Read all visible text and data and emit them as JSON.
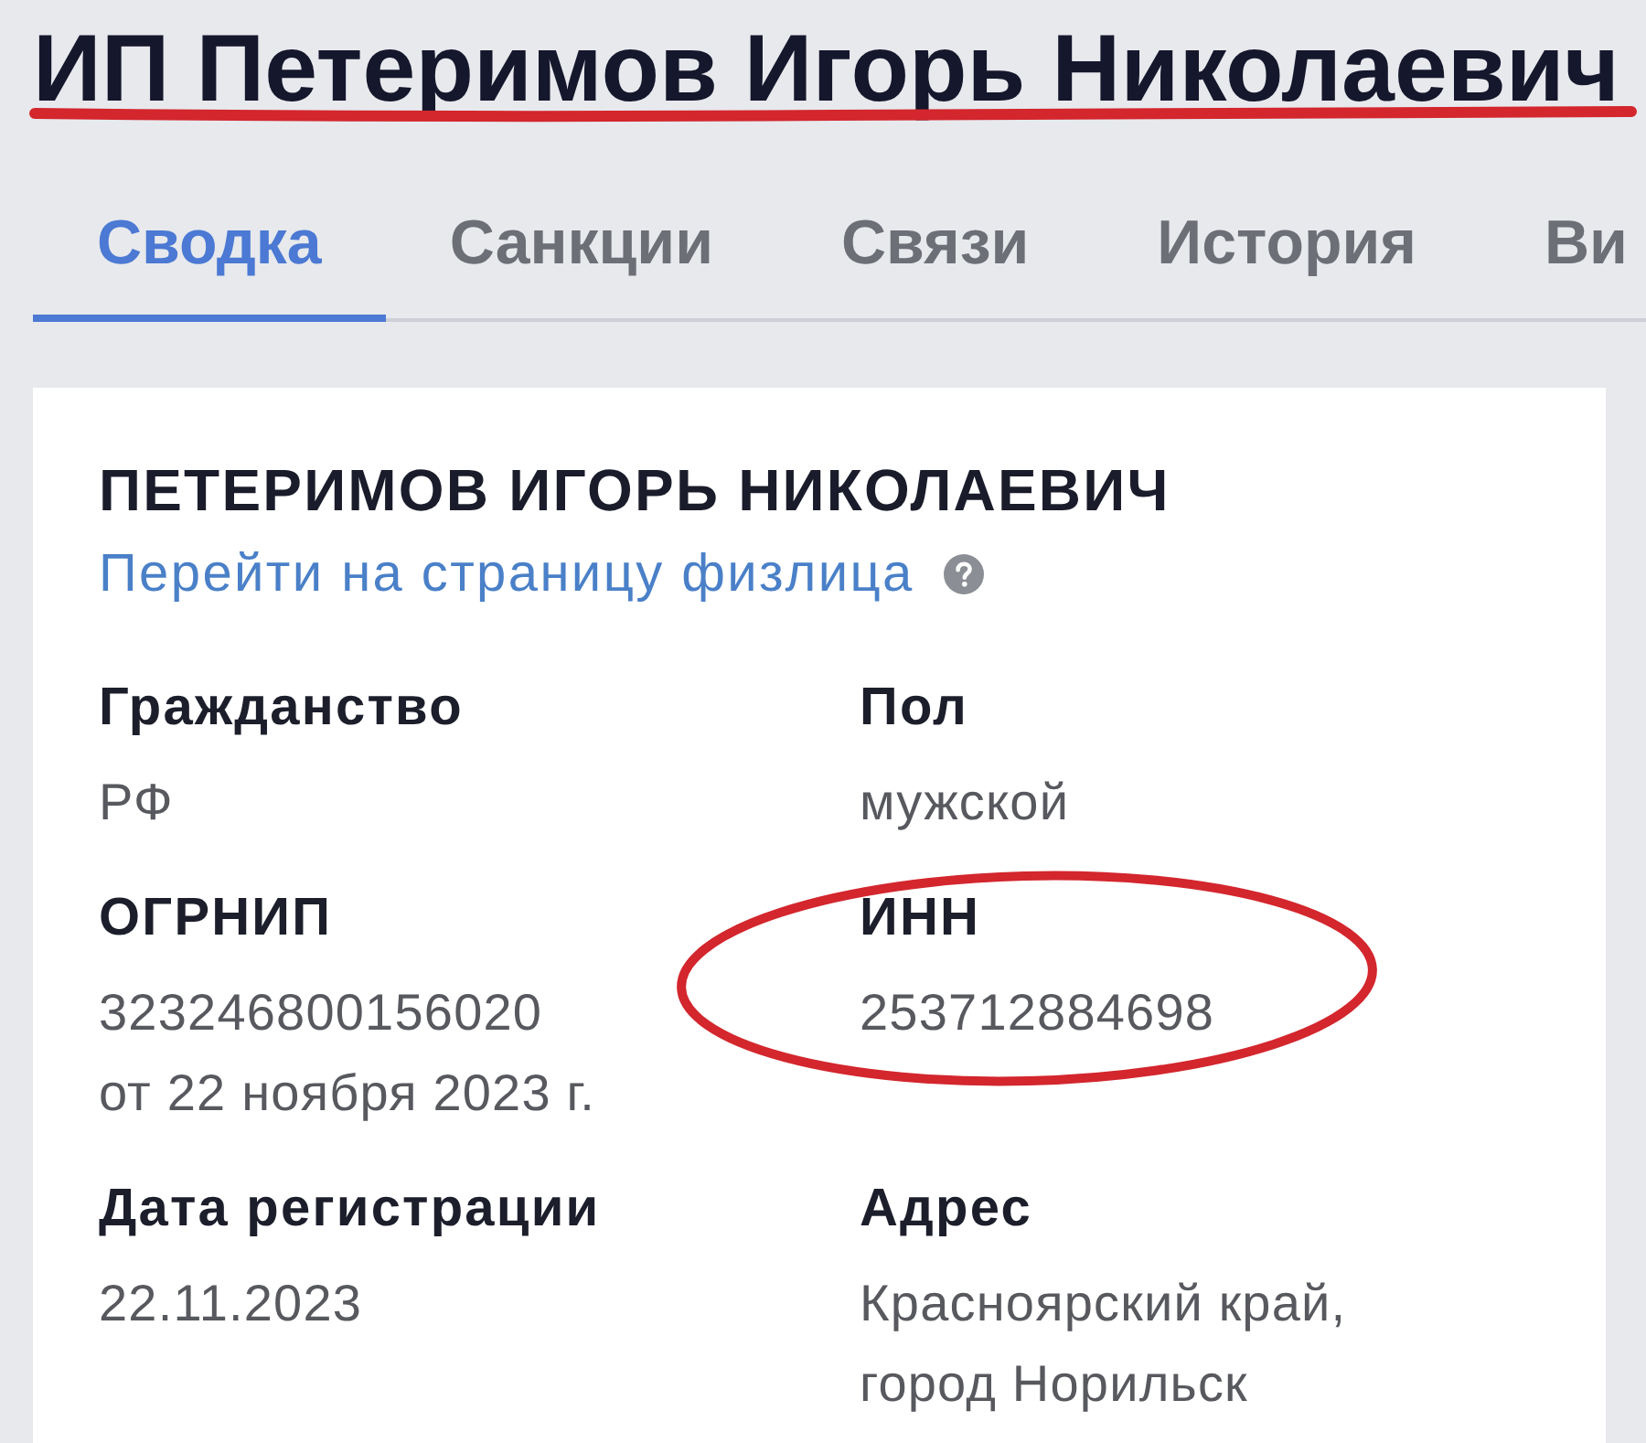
{
  "title": {
    "text": "ИП Петеримов Игорь Николаевич",
    "underlined": true
  },
  "tabs": [
    {
      "label": "Сводка",
      "selected": true
    },
    {
      "label": "Санкции",
      "selected": false
    },
    {
      "label": "Связи",
      "selected": false
    },
    {
      "label": "История",
      "selected": false
    },
    {
      "label": "Ви",
      "selected": false
    }
  ],
  "card": {
    "heading": "ПЕТЕРИМОВ ИГОРЬ НИКОЛАЕВИЧ",
    "link": "Перейти на страницу физлица",
    "fields": [
      {
        "label": "Гражданство",
        "value": [
          "РФ"
        ],
        "circled": false
      },
      {
        "label": "Пол",
        "value": [
          "мужской"
        ],
        "circled": false
      },
      {
        "label": "ОГРНИП",
        "value": [
          "323246800156020",
          "от 22 ноября 2023 г."
        ],
        "circled": false
      },
      {
        "label": "ИНН",
        "value": [
          "253712884698"
        ],
        "circled": true
      },
      {
        "label": "Дата регистрации",
        "value": [
          "22.11.2023"
        ],
        "circled": false
      },
      {
        "label": "Адрес",
        "value": [
          "Красноярский край,",
          "город Норильск"
        ],
        "circled": false
      }
    ]
  }
}
